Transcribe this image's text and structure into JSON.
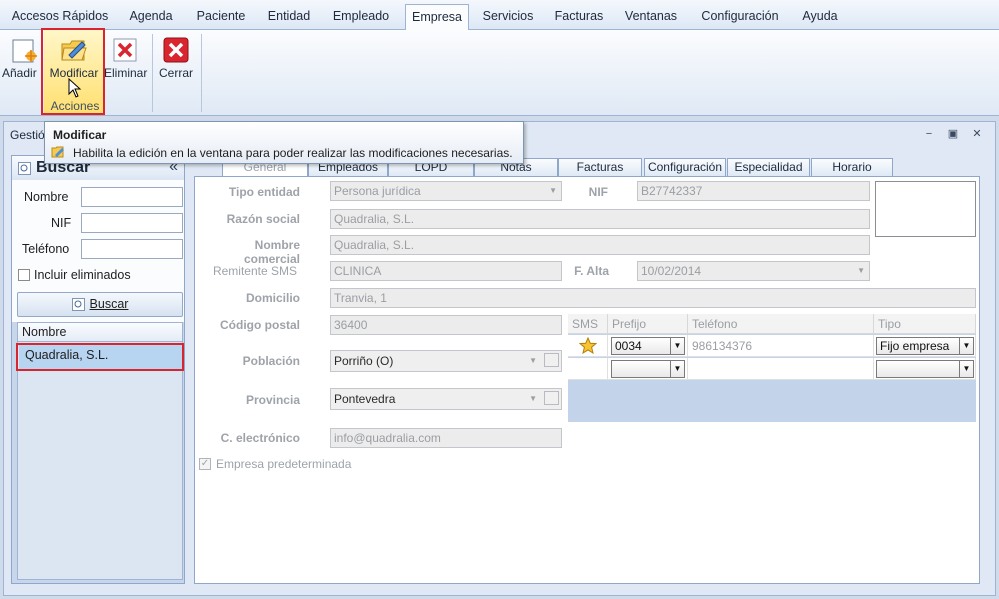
{
  "menu": {
    "tabs": [
      {
        "label": "Accesos Rápidos"
      },
      {
        "label": "Agenda"
      },
      {
        "label": "Paciente"
      },
      {
        "label": "Entidad"
      },
      {
        "label": "Empleado"
      },
      {
        "label": "Empresa"
      },
      {
        "label": "Servicios"
      },
      {
        "label": "Facturas"
      },
      {
        "label": "Ventanas"
      },
      {
        "label": "Configuración"
      },
      {
        "label": "Ayuda"
      }
    ],
    "active": "Empresa"
  },
  "ribbon": {
    "add_label": "Añadir",
    "modify_label": "Modificar",
    "delete_label": "Eliminar",
    "close_label": "Cerrar",
    "group_label": "Acciones"
  },
  "tooltip": {
    "title": "Modificar",
    "description": "Habilita la edición en la ventana para poder realizar las modificaciones necesarias."
  },
  "window": {
    "title": "Gestió"
  },
  "search_panel": {
    "title": "Buscar",
    "collapse_glyph": "«",
    "fields": {
      "nombre": "Nombre",
      "nif": "NIF",
      "telefono": "Teléfono"
    },
    "include_deleted": "Incluir eliminados",
    "search_button": "Buscar",
    "list_header": "Nombre",
    "results": [
      "Quadralia, S.L."
    ]
  },
  "tabs": [
    {
      "label": "General"
    },
    {
      "label": "Empleados"
    },
    {
      "label": "LOPD"
    },
    {
      "label": "Notas"
    },
    {
      "label": "Facturas"
    },
    {
      "label": "Configuración"
    },
    {
      "label": "Especialidad"
    },
    {
      "label": "Horario"
    }
  ],
  "form": {
    "tipo_entidad": {
      "label": "Tipo entidad",
      "value": "Persona jurídica"
    },
    "nif": {
      "label": "NIF",
      "value": "B27742337"
    },
    "razon_social": {
      "label": "Razón social",
      "value": "Quadralia, S.L."
    },
    "nombre_comercial": {
      "label": "Nombre comercial",
      "value": "Quadralia, S.L."
    },
    "remitente_sms": {
      "label": "Remitente SMS",
      "value": "CLINICA"
    },
    "fecha_alta": {
      "label": "F. Alta",
      "value": "10/02/2014"
    },
    "domicilio": {
      "label": "Domicilio",
      "value": "Tranvia, 1"
    },
    "codigo_postal": {
      "label": "Código postal",
      "value": "36400"
    },
    "poblacion": {
      "label": "Población",
      "value": "Porriño (O)"
    },
    "provincia": {
      "label": "Provincia",
      "value": "Pontevedra"
    },
    "correo": {
      "label": "C. electrónico",
      "value": "info@quadralia.com"
    },
    "predeterminada": {
      "label": "Empresa predeterminada",
      "checked": true
    }
  },
  "phones": {
    "headers": {
      "sms": "SMS",
      "prefijo": "Prefijo",
      "telefono": "Teléfono",
      "tipo": "Tipo"
    },
    "rows": [
      {
        "sms_star": true,
        "prefijo": "0034",
        "telefono": "986134376",
        "tipo": "Fijo empresa"
      }
    ]
  },
  "colors": {
    "accent_red": "#d8252f",
    "selection": "#b7d4f1",
    "panel_blue": "#c7d6ea"
  }
}
